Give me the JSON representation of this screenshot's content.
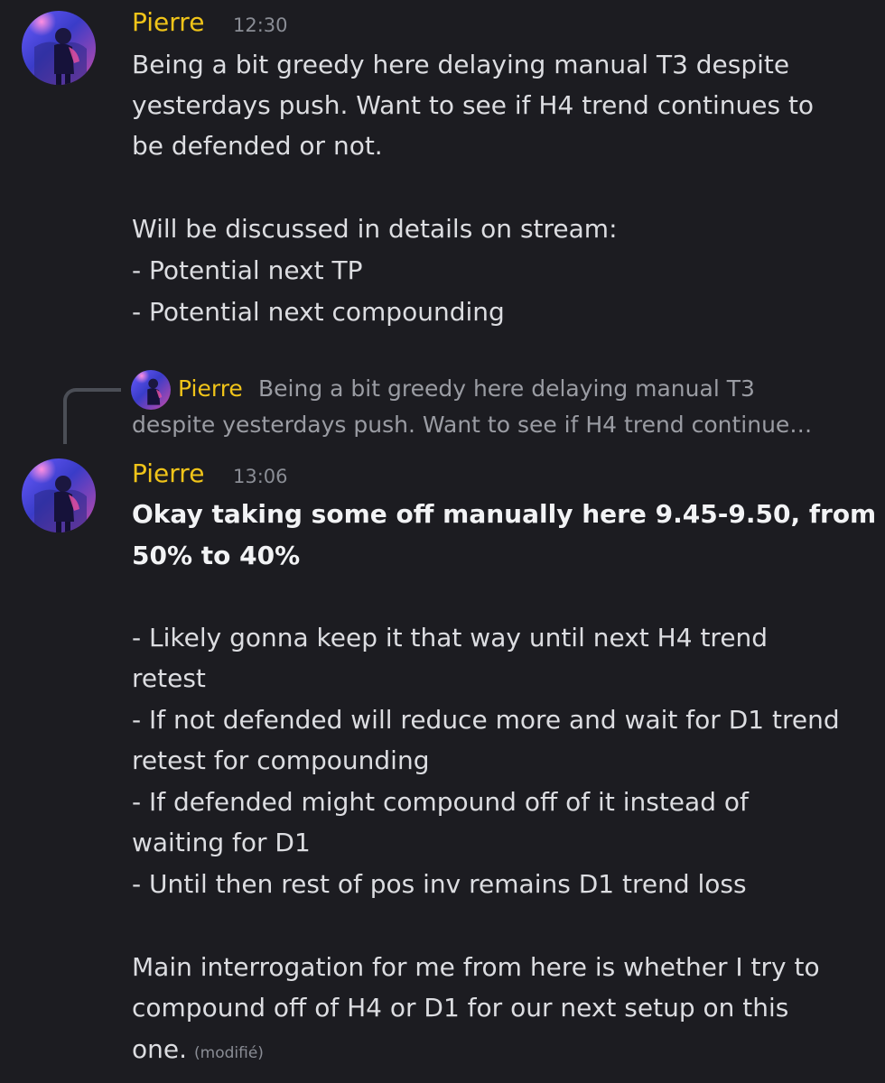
{
  "messages": [
    {
      "author": "Pierre",
      "time": "12:30",
      "lines": [
        "Being a bit greedy here delaying manual T3 despite",
        "yesterdays push. Want to see if H4 trend continues to",
        "be defended or not.",
        "Will be discussed in details on stream:",
        "- Potential next TP",
        "- Potential next compounding"
      ]
    },
    {
      "author": "Pierre",
      "time": "13:06",
      "reply": {
        "author": "Pierre",
        "line1": "Being a bit greedy here delaying manual T3",
        "line2": "despite yesterdays push. Want to see if H4 trend continue…"
      },
      "bold_lines": [
        "Okay taking some off manually here 9.45-9.50, from",
        "50% to 40%"
      ],
      "lines": [
        "- Likely gonna keep it that way until next H4 trend",
        "retest",
        "- If not defended will reduce more and wait for D1 trend",
        "retest for compounding",
        "- If defended might compound off of it instead of",
        "waiting for D1",
        "- Until then rest of pos inv remains D1 trend loss",
        "Main interrogation for me from here is whether I try to",
        "compound off of H4 or D1 for our next setup on this",
        "one."
      ],
      "edited_label": "(modifié)"
    }
  ],
  "icons": {
    "avatar": "user-avatar-icon"
  },
  "colors": {
    "background": "#1c1c21",
    "username": "#f0c419",
    "text": "#dcdde1",
    "timestamp": "#8a8d95",
    "reply_text": "#9a9ca3"
  }
}
